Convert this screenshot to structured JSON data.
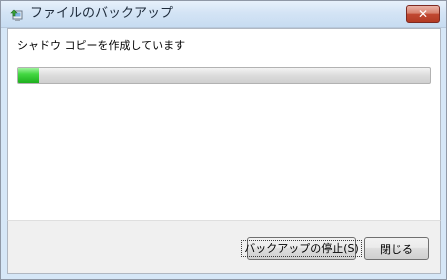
{
  "window": {
    "title": "ファイルのバックアップ",
    "close_glyph": "✕"
  },
  "content": {
    "status_text": "シャドウ コピーを作成しています",
    "progress_fraction": 0.05
  },
  "footer": {
    "stop_button_label": "バックアップの停止(S)",
    "close_button_label": "閉じる"
  },
  "colors": {
    "progress_fill": "#2fc42f",
    "close_button": "#c14932",
    "titlebar": "#d4e4f5"
  },
  "icons": {
    "app": "backup-icon",
    "close": "close-icon"
  }
}
